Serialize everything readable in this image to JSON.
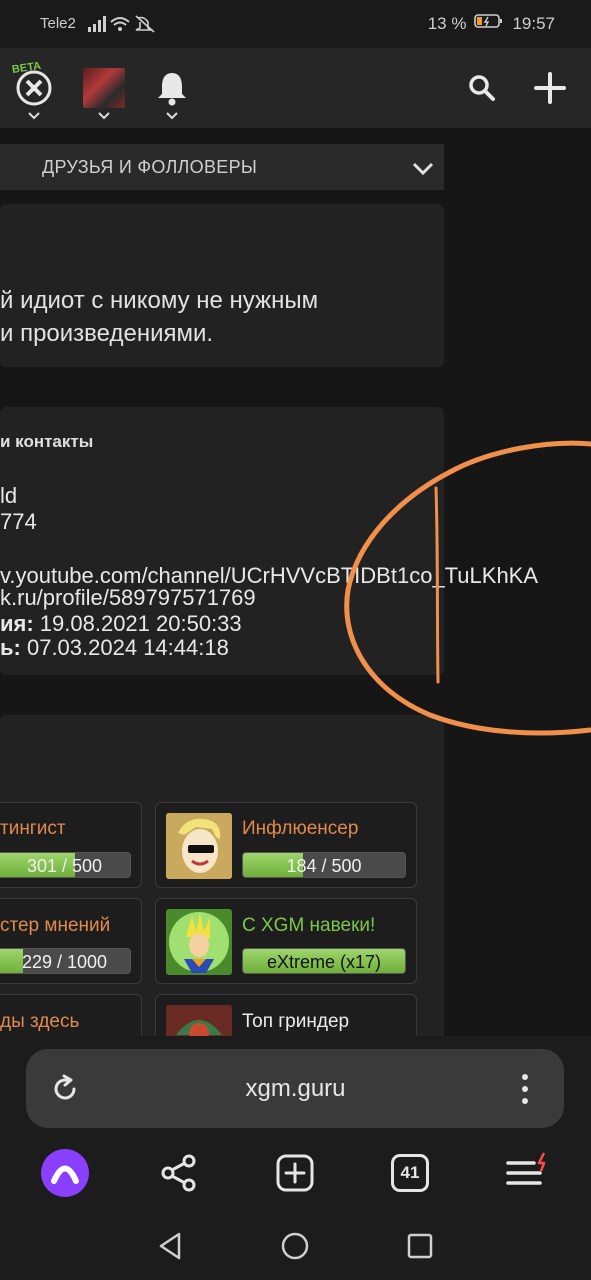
{
  "status": {
    "carrier": "Tele2",
    "battery": "13 %",
    "time": "19:57"
  },
  "nav": {
    "beta_label": "BETA",
    "icons": [
      "xgm-logo-icon",
      "avatar",
      "bell-icon",
      "search-icon",
      "plus-icon"
    ]
  },
  "tabs": {
    "label": "ДРУЗЬЯ И ФОЛЛОВЕРЫ"
  },
  "about": {
    "line1": "й идиот с никому не нужным",
    "line2": "и произведениями."
  },
  "contacts": {
    "title": "и контакты",
    "line1": "ld",
    "line2": "774",
    "youtube": "v.youtube.com/channel/UCrHVVcBTIDBt1co_TuLKhKA",
    "vk": "k.ru/profile/589797571769",
    "registered_label": "ия:",
    "registered_value": " 19.08.2021 20:50:33",
    "last_label": "ь:",
    "last_value": " 07.03.2024 14:44:18"
  },
  "achievements": [
    {
      "title": "тингист",
      "progress_text": "301 / 500",
      "progress": 0.602
    },
    {
      "title": "Инфлюенсер",
      "progress_text": "184 / 500",
      "progress": 0.368
    },
    {
      "title": "стер мнений",
      "progress_text": "229 / 1000",
      "progress": 0.229
    },
    {
      "title": "С XGM навеки!",
      "progress_text": "eXtreme (x17)",
      "progress": 1.0,
      "title_color": "#7cc84a"
    },
    {
      "title": "ды здесь"
    },
    {
      "title": "Топ гриндер",
      "title_color": "#ececec"
    }
  ],
  "browser": {
    "url": "xgm.guru",
    "tabs_count": "41"
  },
  "colors": {
    "accent_orange": "#e08a4e",
    "annotation_orange": "#f0904a",
    "progress_green": "#7cc84a",
    "alice_purple": "#8a3ffc"
  }
}
